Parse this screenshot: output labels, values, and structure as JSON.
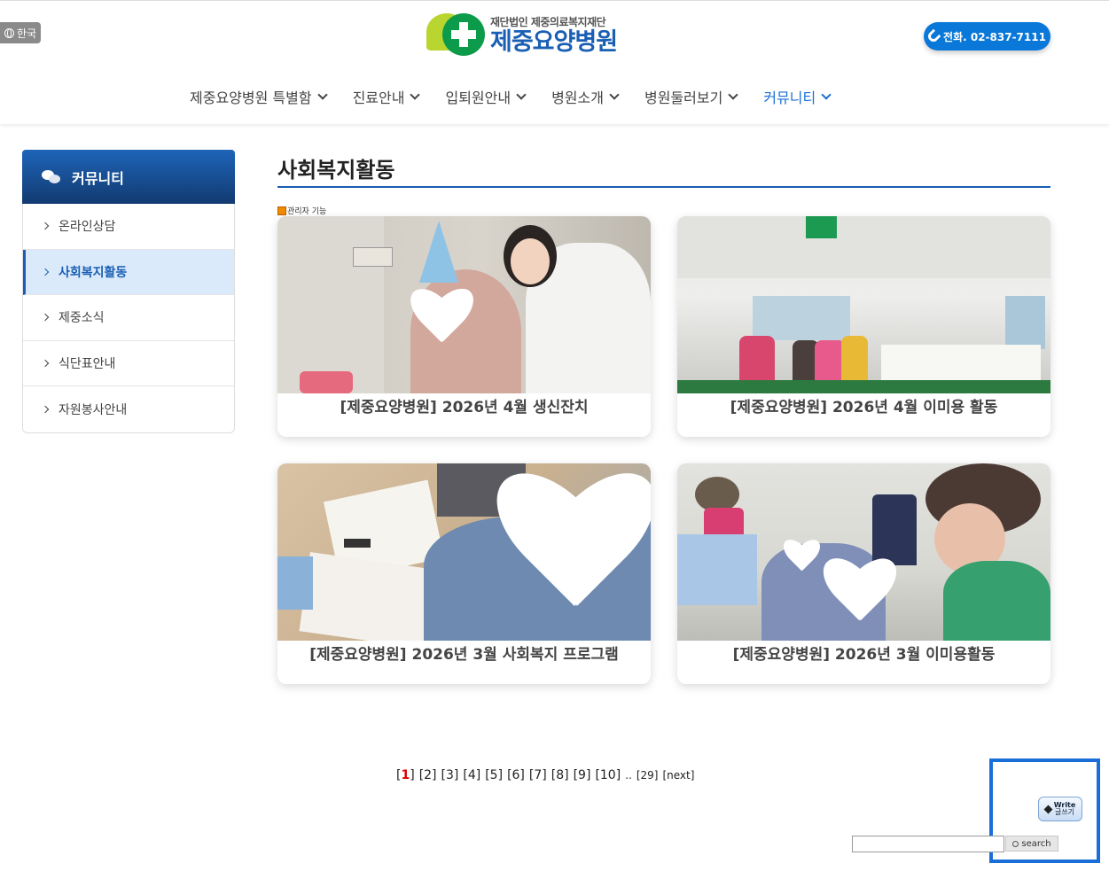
{
  "header": {
    "lang_label": "한국",
    "logo_sub": "재단법인 제중의료복지재단",
    "logo_main": "제중요양병원",
    "phone_label": "전화. 02-837-7111",
    "nav": [
      {
        "label": "제중요양병원 특별함",
        "active": false
      },
      {
        "label": "진료안내",
        "active": false
      },
      {
        "label": "입퇴원안내",
        "active": false
      },
      {
        "label": "병원소개",
        "active": false
      },
      {
        "label": "병원둘러보기",
        "active": false
      },
      {
        "label": "커뮤니티",
        "active": true
      }
    ]
  },
  "sidebar": {
    "title": "커뮤니티",
    "items": [
      {
        "label": "온라인상담",
        "active": false
      },
      {
        "label": "사회복지활동",
        "active": true
      },
      {
        "label": "제중소식",
        "active": false
      },
      {
        "label": "식단표안내",
        "active": false
      },
      {
        "label": "자원봉사안내",
        "active": false
      }
    ]
  },
  "main": {
    "title": "사회복지활동",
    "admin_label": "관리자 기능",
    "posts": [
      {
        "title": "[제중요양병원] 2026년 4월 생신잔치"
      },
      {
        "title": "[제중요양병원] 2026년 4월 이미용 활동"
      },
      {
        "title": "[제중요양병원] 2026년 3월 사회복지 프로그램"
      },
      {
        "title": "[제중요양병원] 2026년 3월 이미용활동"
      }
    ]
  },
  "pagination": {
    "current": "1",
    "pages": [
      "[2]",
      "[3]",
      "[4]",
      "[5]",
      "[6]",
      "[7]",
      "[8]",
      "[9]",
      "[10]"
    ],
    "ellipsis": "..",
    "last": "[29]",
    "next": "[next]"
  },
  "actions": {
    "write_top": "Write",
    "write_bottom": "글쓰기",
    "search_value": "",
    "search_label": "search"
  },
  "colors": {
    "primary": "#1a5fb4",
    "accent": "#0a78d8",
    "active_bg": "#dbeafb",
    "current_page": "#dd0000"
  }
}
